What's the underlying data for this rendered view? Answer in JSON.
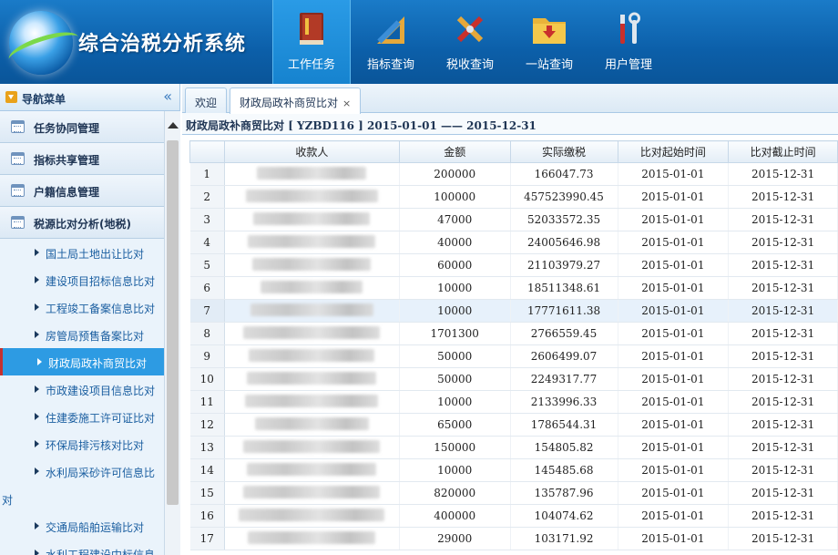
{
  "app": {
    "title": "综合治税分析系统"
  },
  "topnav": [
    {
      "label": "工作任务",
      "icon": "book-icon",
      "active": true
    },
    {
      "label": "指标查询",
      "icon": "ruler-triangle-icon",
      "active": false
    },
    {
      "label": "税收查询",
      "icon": "pencil-ruler-icon",
      "active": false
    },
    {
      "label": "一站查询",
      "icon": "folder-icon",
      "active": false
    },
    {
      "label": "用户管理",
      "icon": "tools-icon",
      "active": false
    }
  ],
  "sidebar": {
    "header": "导航菜单",
    "collapse_glyph": "«",
    "groups": [
      {
        "label": "任务协同管理"
      },
      {
        "label": "指标共享管理"
      },
      {
        "label": "户籍信息管理"
      },
      {
        "label": "税源比对分析(地税)"
      }
    ],
    "items": [
      {
        "label": "国土局土地出让比对"
      },
      {
        "label": "建设项目招标信息比对"
      },
      {
        "label": "工程竣工备案信息比对"
      },
      {
        "label": "房管局预售备案比对"
      },
      {
        "label": "财政局政补商贸比对",
        "selected": true
      },
      {
        "label": "市政建设项目信息比对"
      },
      {
        "label": "住建委施工许可证比对"
      },
      {
        "label": "环保局排污核对比对"
      },
      {
        "label": "水利局采砂许可信息比",
        "label_cont": "对"
      },
      {
        "label": "交通局船舶运输比对"
      },
      {
        "label": "水利工程建设中标信息"
      }
    ]
  },
  "tabs": [
    {
      "label": "欢迎",
      "closable": false
    },
    {
      "label": "财政局政补商贸比对",
      "closable": true,
      "close_glyph": "×"
    }
  ],
  "panel": {
    "title": "财政局政补商贸比对",
    "code": "[ YZBD116 ]",
    "range": "2015-01-01 —— 2015-12-31"
  },
  "table": {
    "columns": [
      "收款人",
      "金额",
      "实际缴税",
      "比对起始时间",
      "比对截止时间"
    ],
    "rows": [
      {
        "n": "1",
        "amount": "200000",
        "tax": "166047.73",
        "start": "2015-01-01",
        "end": "2015-12-31"
      },
      {
        "n": "2",
        "amount": "100000",
        "tax": "457523990.45",
        "start": "2015-01-01",
        "end": "2015-12-31"
      },
      {
        "n": "3",
        "amount": "47000",
        "tax": "52033572.35",
        "start": "2015-01-01",
        "end": "2015-12-31"
      },
      {
        "n": "4",
        "amount": "40000",
        "tax": "24005646.98",
        "start": "2015-01-01",
        "end": "2015-12-31"
      },
      {
        "n": "5",
        "amount": "60000",
        "tax": "21103979.27",
        "start": "2015-01-01",
        "end": "2015-12-31"
      },
      {
        "n": "6",
        "amount": "10000",
        "tax": "18511348.61",
        "start": "2015-01-01",
        "end": "2015-12-31"
      },
      {
        "n": "7",
        "amount": "10000",
        "tax": "17771611.38",
        "start": "2015-01-01",
        "end": "2015-12-31",
        "highlight": true
      },
      {
        "n": "8",
        "amount": "1701300",
        "tax": "2766559.45",
        "start": "2015-01-01",
        "end": "2015-12-31"
      },
      {
        "n": "9",
        "amount": "50000",
        "tax": "2606499.07",
        "start": "2015-01-01",
        "end": "2015-12-31"
      },
      {
        "n": "10",
        "amount": "50000",
        "tax": "2249317.77",
        "start": "2015-01-01",
        "end": "2015-12-31"
      },
      {
        "n": "11",
        "amount": "10000",
        "tax": "2133996.33",
        "start": "2015-01-01",
        "end": "2015-12-31"
      },
      {
        "n": "12",
        "amount": "65000",
        "tax": "1786544.31",
        "start": "2015-01-01",
        "end": "2015-12-31"
      },
      {
        "n": "13",
        "amount": "150000",
        "tax": "154805.82",
        "start": "2015-01-01",
        "end": "2015-12-31"
      },
      {
        "n": "14",
        "amount": "10000",
        "tax": "145485.68",
        "start": "2015-01-01",
        "end": "2015-12-31"
      },
      {
        "n": "15",
        "amount": "820000",
        "tax": "135787.96",
        "start": "2015-01-01",
        "end": "2015-12-31"
      },
      {
        "n": "16",
        "amount": "400000",
        "tax": "104074.62",
        "start": "2015-01-01",
        "end": "2015-12-31"
      },
      {
        "n": "17",
        "amount": "29000",
        "tax": "103171.92",
        "start": "2015-01-01",
        "end": "2015-12-31"
      }
    ]
  },
  "colors": {
    "header": "#0c5fa9",
    "accent": "#2d9be3",
    "selection_marker": "#c43030"
  }
}
